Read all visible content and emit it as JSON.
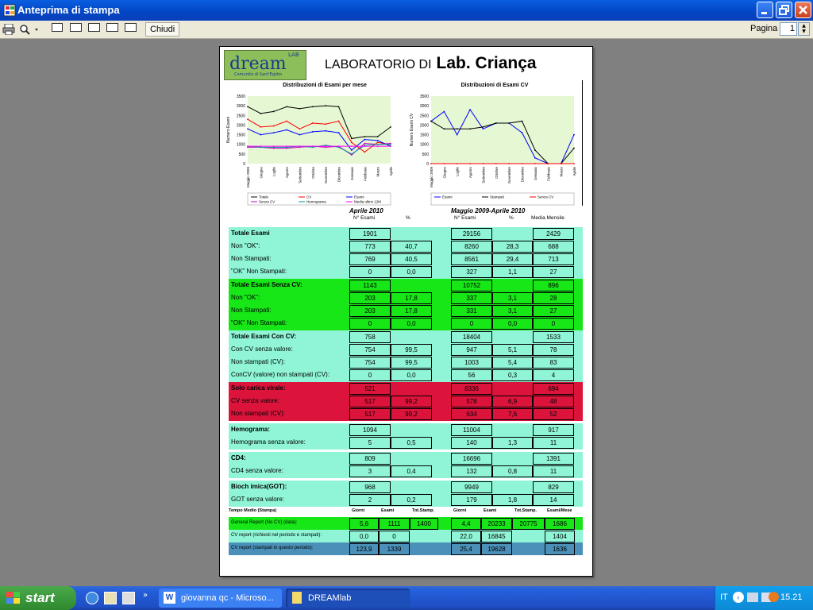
{
  "window": {
    "title": "Anteprima di stampa",
    "close_label": "Chiudi",
    "page_label": "Pagina",
    "page_value": "1"
  },
  "report": {
    "lab_prefix": "LABORATORIO DI",
    "lab_name": "Lab. Criança",
    "logo": {
      "word": "dream",
      "tag": "LAB",
      "sub": "Comunità di Sant'Egidio"
    },
    "headers": {
      "p1": "Aprile 2010",
      "p2": "Maggio 2009-Aprile 2010",
      "n_esami": "N° Esami",
      "pct": "%",
      "media": "Media Mensile"
    },
    "sections": [
      {
        "bg": "#8ff5d6",
        "rows": [
          {
            "label": "Totale Esami",
            "bold": true,
            "v": [
              "1901",
              "",
              "29156",
              "",
              "2429"
            ]
          },
          {
            "label": "Non \"OK\":",
            "v": [
              "773",
              "40,7",
              "8260",
              "28,3",
              "688"
            ]
          },
          {
            "label": "Non Stampati:",
            "v": [
              "769",
              "40,5",
              "8561",
              "29,4",
              "713"
            ]
          },
          {
            "label": "\"OK\" Non Stampati:",
            "v": [
              "0",
              "0,0",
              "327",
              "1,1",
              "27"
            ]
          }
        ]
      },
      {
        "bg": "#17e617",
        "rows": [
          {
            "label": "Totale Esami Senza CV:",
            "bold": true,
            "v": [
              "1143",
              "",
              "10752",
              "",
              "896"
            ]
          },
          {
            "label": "Non \"OK\":",
            "v": [
              "203",
              "17,8",
              "337",
              "3,1",
              "28"
            ]
          },
          {
            "label": "Non Stampati:",
            "v": [
              "203",
              "17,8",
              "331",
              "3,1",
              "27"
            ]
          },
          {
            "label": "\"OK\" Non Stampati:",
            "v": [
              "0",
              "0,0",
              "0",
              "0,0",
              "0"
            ]
          }
        ]
      },
      {
        "bg": "#8ff5d6",
        "rows": [
          {
            "label": "Totale Esami Con CV:",
            "bold": true,
            "v": [
              "758",
              "",
              "18404",
              "",
              "1533"
            ]
          },
          {
            "label": "Con CV senza valore:",
            "v": [
              "754",
              "99,5",
              "947",
              "5,1",
              "78"
            ]
          },
          {
            "label": "Non stampati (CV):",
            "v": [
              "754",
              "99,5",
              "1003",
              "5,4",
              "83"
            ]
          },
          {
            "label": "ConCV (valore) non stampati (CV):",
            "v": [
              "0",
              "0,0",
              "56",
              "0,3",
              "4"
            ]
          }
        ]
      },
      {
        "bg": "#dc143c",
        "rows": [
          {
            "label": "Solo carica virale:",
            "bold": true,
            "v": [
              "521",
              "",
              "8336",
              "",
              "694"
            ]
          },
          {
            "label": "CV senza valore:",
            "v": [
              "517",
              "99,2",
              "578",
              "6,9",
              "48"
            ]
          },
          {
            "label": "Non stampati (CV):",
            "v": [
              "517",
              "99,2",
              "634",
              "7,6",
              "52"
            ]
          }
        ]
      },
      {
        "bg": "#8ff5d6",
        "gap": true,
        "rows": [
          {
            "label": "Hemograma:",
            "bold": true,
            "v": [
              "1094",
              "",
              "11004",
              "",
              "917"
            ]
          },
          {
            "label": "Hemograma senza valore:",
            "v": [
              "5",
              "0,5",
              "140",
              "1,3",
              "11"
            ]
          }
        ]
      },
      {
        "bg": "#8ff5d6",
        "gap": true,
        "rows": [
          {
            "label": "CD4:",
            "bold": true,
            "v": [
              "809",
              "",
              "16696",
              "",
              "1391"
            ]
          },
          {
            "label": "CD4 senza valore:",
            "v": [
              "3",
              "0,4",
              "132",
              "0,8",
              "11"
            ]
          }
        ]
      },
      {
        "bg": "#8ff5d6",
        "gap": true,
        "rows": [
          {
            "label": "Bioch imica(GOT):",
            "bold": true,
            "v": [
              "968",
              "",
              "9949",
              "",
              "829"
            ]
          },
          {
            "label": "GOT senza valore:",
            "v": [
              "2",
              "0,2",
              "179",
              "1,8",
              "14"
            ]
          }
        ]
      }
    ],
    "tempo": {
      "title": "Tempo Medio (Stampa)",
      "headers": [
        "Giorni",
        "Esami",
        "Tot.Stamp.",
        "Giorni",
        "Esami",
        "Tot.Stamp.",
        "Esami/Mese"
      ],
      "rows": [
        {
          "label": "General Report (No CV) (data):",
          "bg": "#17e617",
          "v": [
            "5,6",
            "1111",
            "1400",
            "4,4",
            "20233",
            "20775",
            "1686"
          ]
        },
        {
          "label": "CV report (richiesti nel periodo e stampati):",
          "bg": "#8ff5d6",
          "v": [
            "0,0",
            "0",
            "",
            "22,0",
            "16845",
            "",
            "1404"
          ]
        },
        {
          "label": "CV report (stampati in questo periodo):",
          "bg": "#4a90b8",
          "v": [
            "123,9",
            "1339",
            "",
            "25,4",
            "19628",
            "",
            "1636"
          ]
        }
      ]
    }
  },
  "chart_data": [
    {
      "type": "line",
      "title": "Distribuzioni di Esami per mese",
      "ylabel": "Numero Esami",
      "ylim": [
        0,
        3500
      ],
      "yticks": [
        "0",
        "500",
        "1000",
        "1500",
        "2000",
        "2500",
        "3000",
        "3500"
      ],
      "categories": [
        "Maggio 2009",
        "Giugno",
        "Luglio",
        "Agosto",
        "Settembre",
        "Ottobre",
        "Novembre",
        "Dicembre",
        "Gennaio",
        "Febbraio",
        "Marzo",
        "Aprile"
      ],
      "legend": [
        "Totale",
        "CV",
        "Esami",
        "Senza CV",
        "Hemograma",
        "Media ultimi 12M"
      ],
      "series": [
        {
          "color": "#000000",
          "values": [
            2950,
            2600,
            2700,
            2950,
            2850,
            2950,
            3000,
            2950,
            1300,
            1400,
            1400,
            1900
          ]
        },
        {
          "color": "#ff0000",
          "values": [
            2300,
            1900,
            1950,
            2200,
            1800,
            2100,
            2050,
            2200,
            1100,
            600,
            1100,
            1000
          ]
        },
        {
          "color": "#0000ff",
          "values": [
            1800,
            1500,
            1600,
            1750,
            1500,
            1650,
            1700,
            1600,
            700,
            1250,
            1200,
            900
          ]
        },
        {
          "color": "#cc00cc",
          "values": [
            850,
            850,
            800,
            800,
            850,
            900,
            850,
            900,
            450,
            1050,
            1000,
            1050
          ]
        },
        {
          "color": "#009999",
          "values": [
            900,
            850,
            850,
            850,
            900,
            850,
            950,
            850,
            500,
            950,
            1000,
            1000
          ]
        },
        {
          "color": "#ff00ff",
          "values": [
            900,
            900,
            900,
            900,
            900,
            900,
            900,
            900,
            900,
            900,
            900,
            900
          ]
        }
      ]
    },
    {
      "type": "line",
      "title": "Distribuzioni di Esami CV",
      "ylabel": "Numero Esami CV",
      "ylim": [
        0,
        3500
      ],
      "yticks": [
        "0",
        "500",
        "1000",
        "1500",
        "2000",
        "2500",
        "3000",
        "3500"
      ],
      "categories": [
        "Maggio 2009",
        "Giugno",
        "Luglio",
        "Agosto",
        "Settembre",
        "Ottobre",
        "Novembre",
        "Dicembre",
        "Gennaio",
        "Febbraio",
        "Marzo",
        "Aprile"
      ],
      "legend": [
        "Esami",
        "Stampati",
        "Senza CV"
      ],
      "series": [
        {
          "color": "#0000ff",
          "values": [
            2200,
            2700,
            1500,
            2800,
            1800,
            2100,
            2100,
            1600,
            300,
            0,
            0,
            1500
          ]
        },
        {
          "color": "#000000",
          "values": [
            2200,
            1800,
            1800,
            1800,
            1900,
            2100,
            2100,
            2200,
            700,
            0,
            0,
            800
          ]
        },
        {
          "color": "#ff0000",
          "values": [
            0,
            0,
            0,
            0,
            0,
            0,
            0,
            0,
            0,
            0,
            0,
            0
          ]
        }
      ]
    }
  ],
  "taskbar": {
    "start": "start",
    "tasks": [
      "giovanna qc - Microso...",
      "DREAMlab"
    ],
    "lang": "IT",
    "clock": "15.21"
  }
}
